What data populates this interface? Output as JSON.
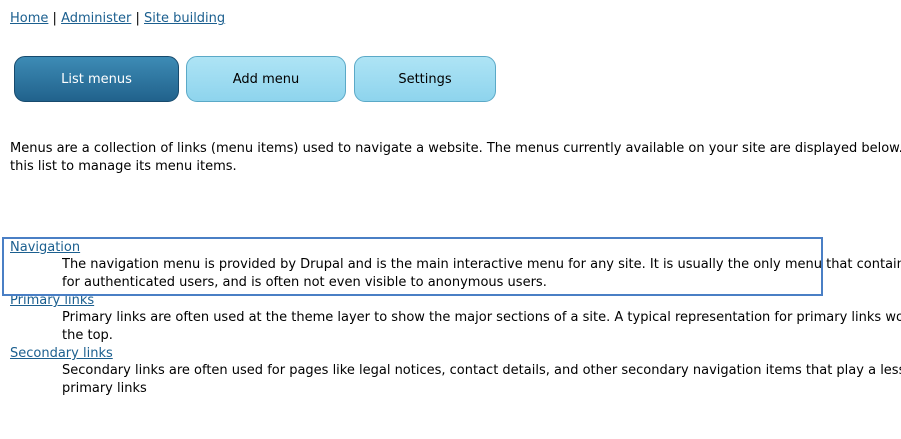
{
  "breadcrumb": {
    "items": [
      "Home",
      "Administer",
      "Site building"
    ],
    "separator": "|"
  },
  "tabs": [
    {
      "label": "List menus",
      "active": true
    },
    {
      "label": "Add menu",
      "active": false
    },
    {
      "label": "Settings",
      "active": false
    }
  ],
  "intro": {
    "line1": "Menus are a collection of links (menu items) used to navigate a website. The menus currently available on your site are displayed below. Select a menu from",
    "line2": "this list to manage its menu items."
  },
  "menus": [
    {
      "title": "Navigation",
      "desc_line1": "The navigation menu is provided by Drupal and is the main interactive menu for any site. It is usually the only menu that contains personalized links",
      "desc_line2": "for authenticated users, and is often not even visible to anonymous users."
    },
    {
      "title": "Primary links",
      "desc_line1": "Primary links are often used at the theme layer to show the major sections of a site. A typical representation for primary links would be tabs along",
      "desc_line2": "the top."
    },
    {
      "title": "Secondary links",
      "desc_line1": "Secondary links are often used for pages like legal notices, contact details, and other secondary navigation items that play a lesser role than",
      "desc_line2": "primary links"
    }
  ],
  "colors": {
    "link": "#1b5f8f",
    "active_tab": "#21628c",
    "inactive_tab": "#9edbf0",
    "highlight_border": "#4a7fc5"
  }
}
